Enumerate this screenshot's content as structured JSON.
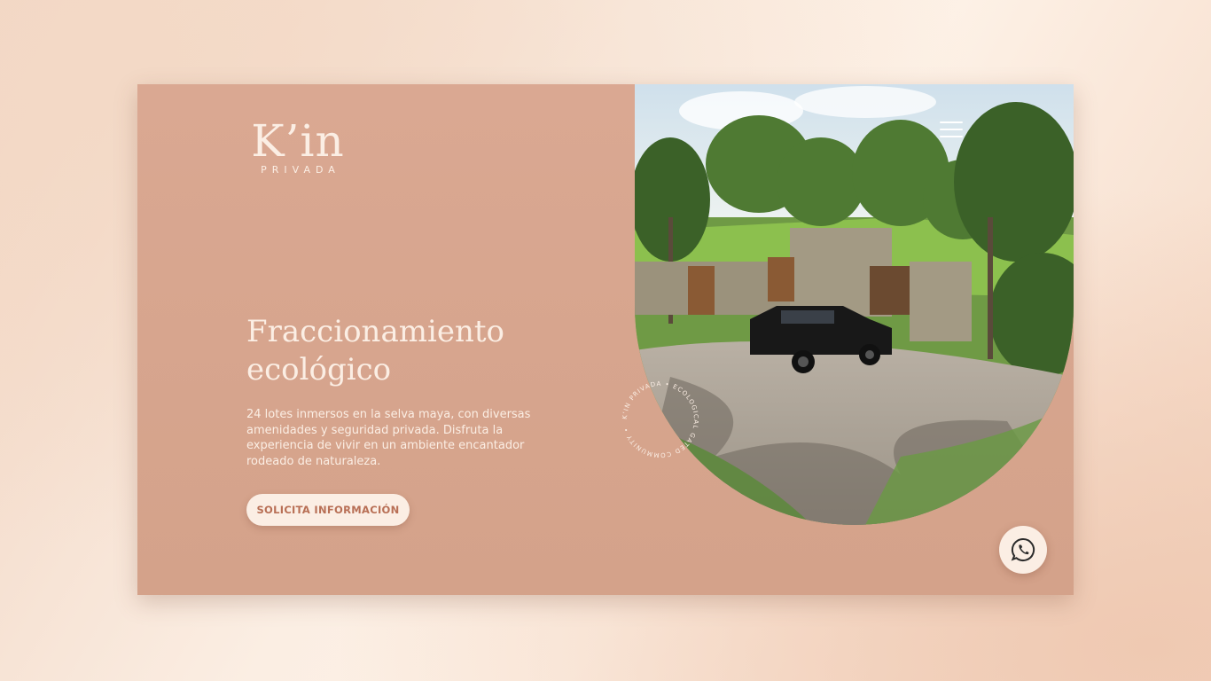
{
  "brand": {
    "name": "K’in",
    "subtitle": "PRIVADA"
  },
  "hero": {
    "title_line1": "Fraccionamiento",
    "title_line2": "ecológico",
    "description": "24 lotes inmersos en la selva maya, con diversas amenidades y seguridad privada. Disfruta la experiencia de vivir en un ambiente encantador rodeado de naturaleza.",
    "cta_label": "SOLICITA INFORMACIÓN"
  },
  "stamp": {
    "text": "K’IN PRIVADA • ECOLOGICAL GATED COMMUNITY •"
  },
  "icons": {
    "menu": "hamburger-menu-icon",
    "whatsapp": "whatsapp-icon"
  },
  "colors": {
    "panel": "#d9a690",
    "cream": "#fbeee4",
    "accent_text": "#b86f55"
  }
}
